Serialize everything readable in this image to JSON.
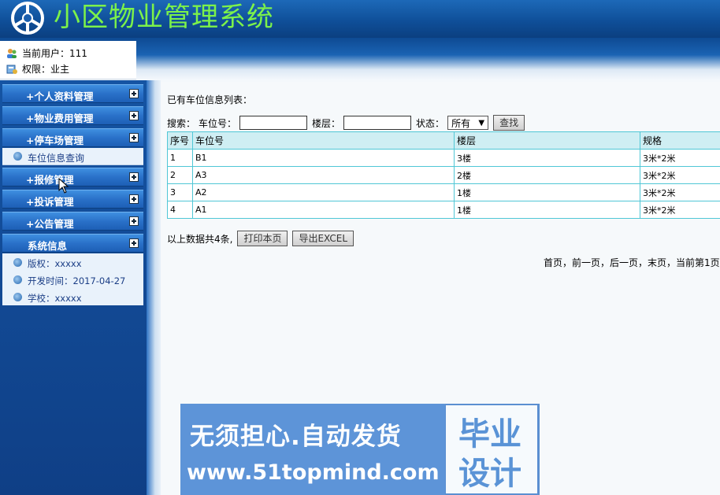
{
  "header": {
    "app_title": "小区物业管理系统"
  },
  "user": {
    "current_label": "当前用户：111",
    "role_label": "权限：业主"
  },
  "sidebar": {
    "items": [
      {
        "label": "+个人资料管理"
      },
      {
        "label": "+物业费用管理"
      },
      {
        "label": "+停车场管理"
      },
      {
        "label": "+报修管理"
      },
      {
        "label": "+投诉管理"
      },
      {
        "label": "+公告管理"
      },
      {
        "label": "系统信息"
      }
    ],
    "parking_sub": {
      "label": "车位信息查询"
    },
    "system_info": [
      {
        "label": "版权：xxxxx"
      },
      {
        "label": "开发时间：2017-04-27"
      },
      {
        "label": "学校：xxxxx"
      }
    ]
  },
  "main": {
    "list_title": "已有车位信息列表：",
    "search": {
      "prefix": "搜索：",
      "space_label": "车位号：",
      "space_value": "",
      "floor_label": "楼层：",
      "floor_value": "",
      "status_label": "状态：",
      "status_selected": "所有",
      "find_button": "查找"
    },
    "table": {
      "headers": [
        "序号",
        "车位号",
        "楼层",
        "规格"
      ],
      "rows": [
        [
          "1",
          "B1",
          "3楼",
          "3米*2米"
        ],
        [
          "2",
          "A3",
          "2楼",
          "3米*2米"
        ],
        [
          "3",
          "A2",
          "1楼",
          "3米*2米"
        ],
        [
          "4",
          "A1",
          "1楼",
          "3米*2米"
        ]
      ]
    },
    "summary": "以上数据共4条,",
    "print_button": "打印本页",
    "export_button": "导出EXCEL",
    "pager": "首页，前一页，后一页，末页，当前第1页"
  },
  "watermark": {
    "line1": "无须担心.自动发货",
    "line2": "www.51topmind.com",
    "right1": "毕业",
    "right2": "设计"
  }
}
